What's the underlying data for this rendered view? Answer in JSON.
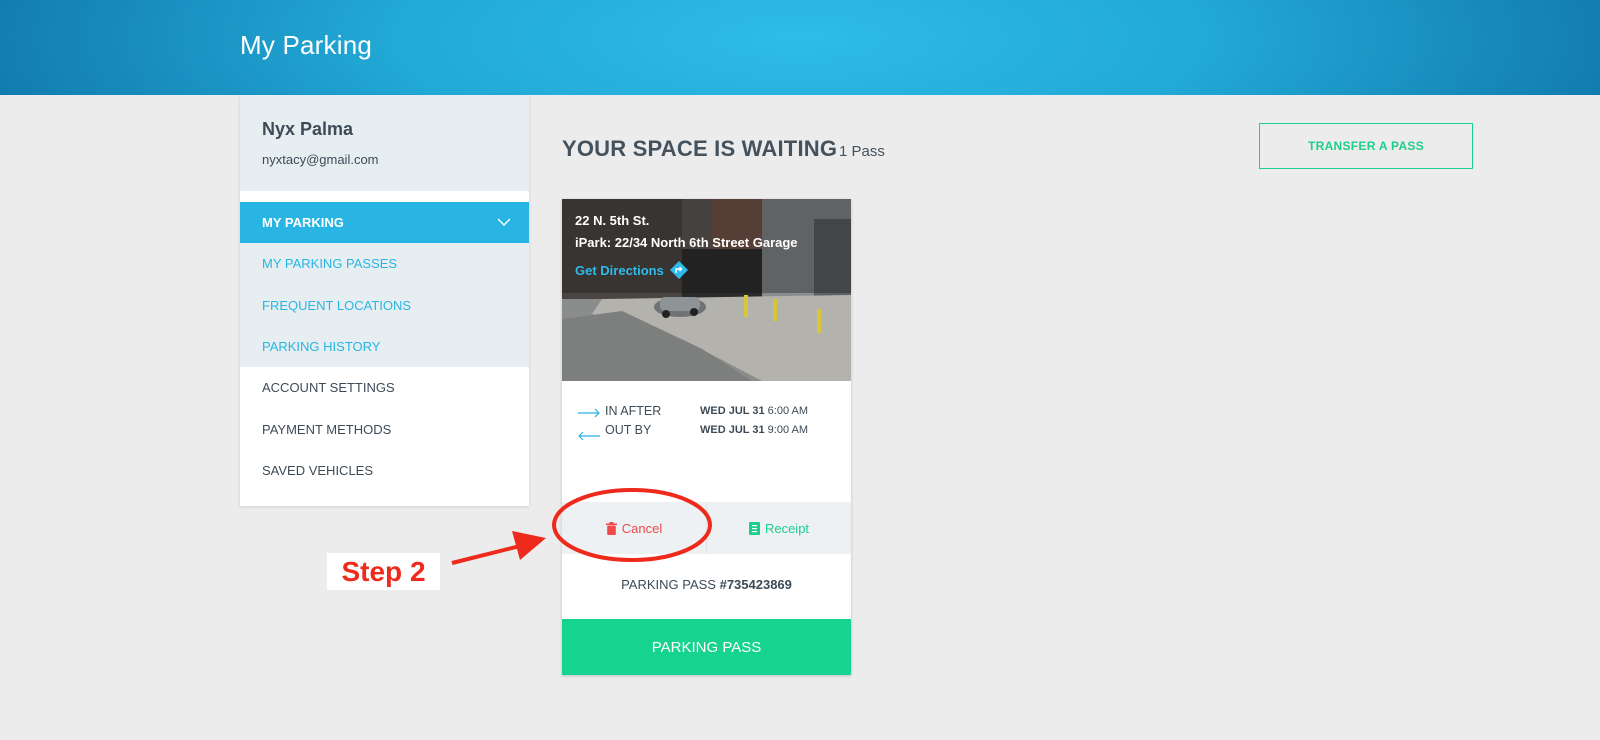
{
  "header": {
    "title": "My Parking"
  },
  "profile": {
    "name": "Nyx Palma",
    "email": "nyxtacy@gmail.com"
  },
  "sidebar": {
    "active": "MY PARKING",
    "sub_items": [
      "MY PARKING PASSES",
      "FREQUENT LOCATIONS",
      "PARKING HISTORY"
    ],
    "items": [
      "ACCOUNT SETTINGS",
      "PAYMENT METHODS",
      "SAVED VEHICLES"
    ]
  },
  "main": {
    "heading": "YOUR SPACE IS WAITING",
    "pass_count": "1 Pass",
    "transfer_label": "TRANSFER A PASS"
  },
  "card": {
    "address": "22 N. 5th St.",
    "garage": "iPark: 22/34 North 6th Street Garage",
    "directions": "Get Directions",
    "in_label": "IN AFTER",
    "in_day": "WED JUL 31",
    "in_time": "6:00 AM",
    "out_label": "OUT BY",
    "out_day": "WED JUL 31",
    "out_time": "9:00 AM",
    "cancel_label": "Cancel",
    "receipt_label": "Receipt",
    "pass_prefix": "PARKING PASS ",
    "pass_number": "#735423869",
    "pass_button": "PARKING PASS"
  },
  "annotation": {
    "step": "Step 2",
    "color": "#ee2a1c"
  },
  "colors": {
    "accent": "#29b5e3",
    "green": "#16d38f",
    "red": "#ee4a4a"
  }
}
